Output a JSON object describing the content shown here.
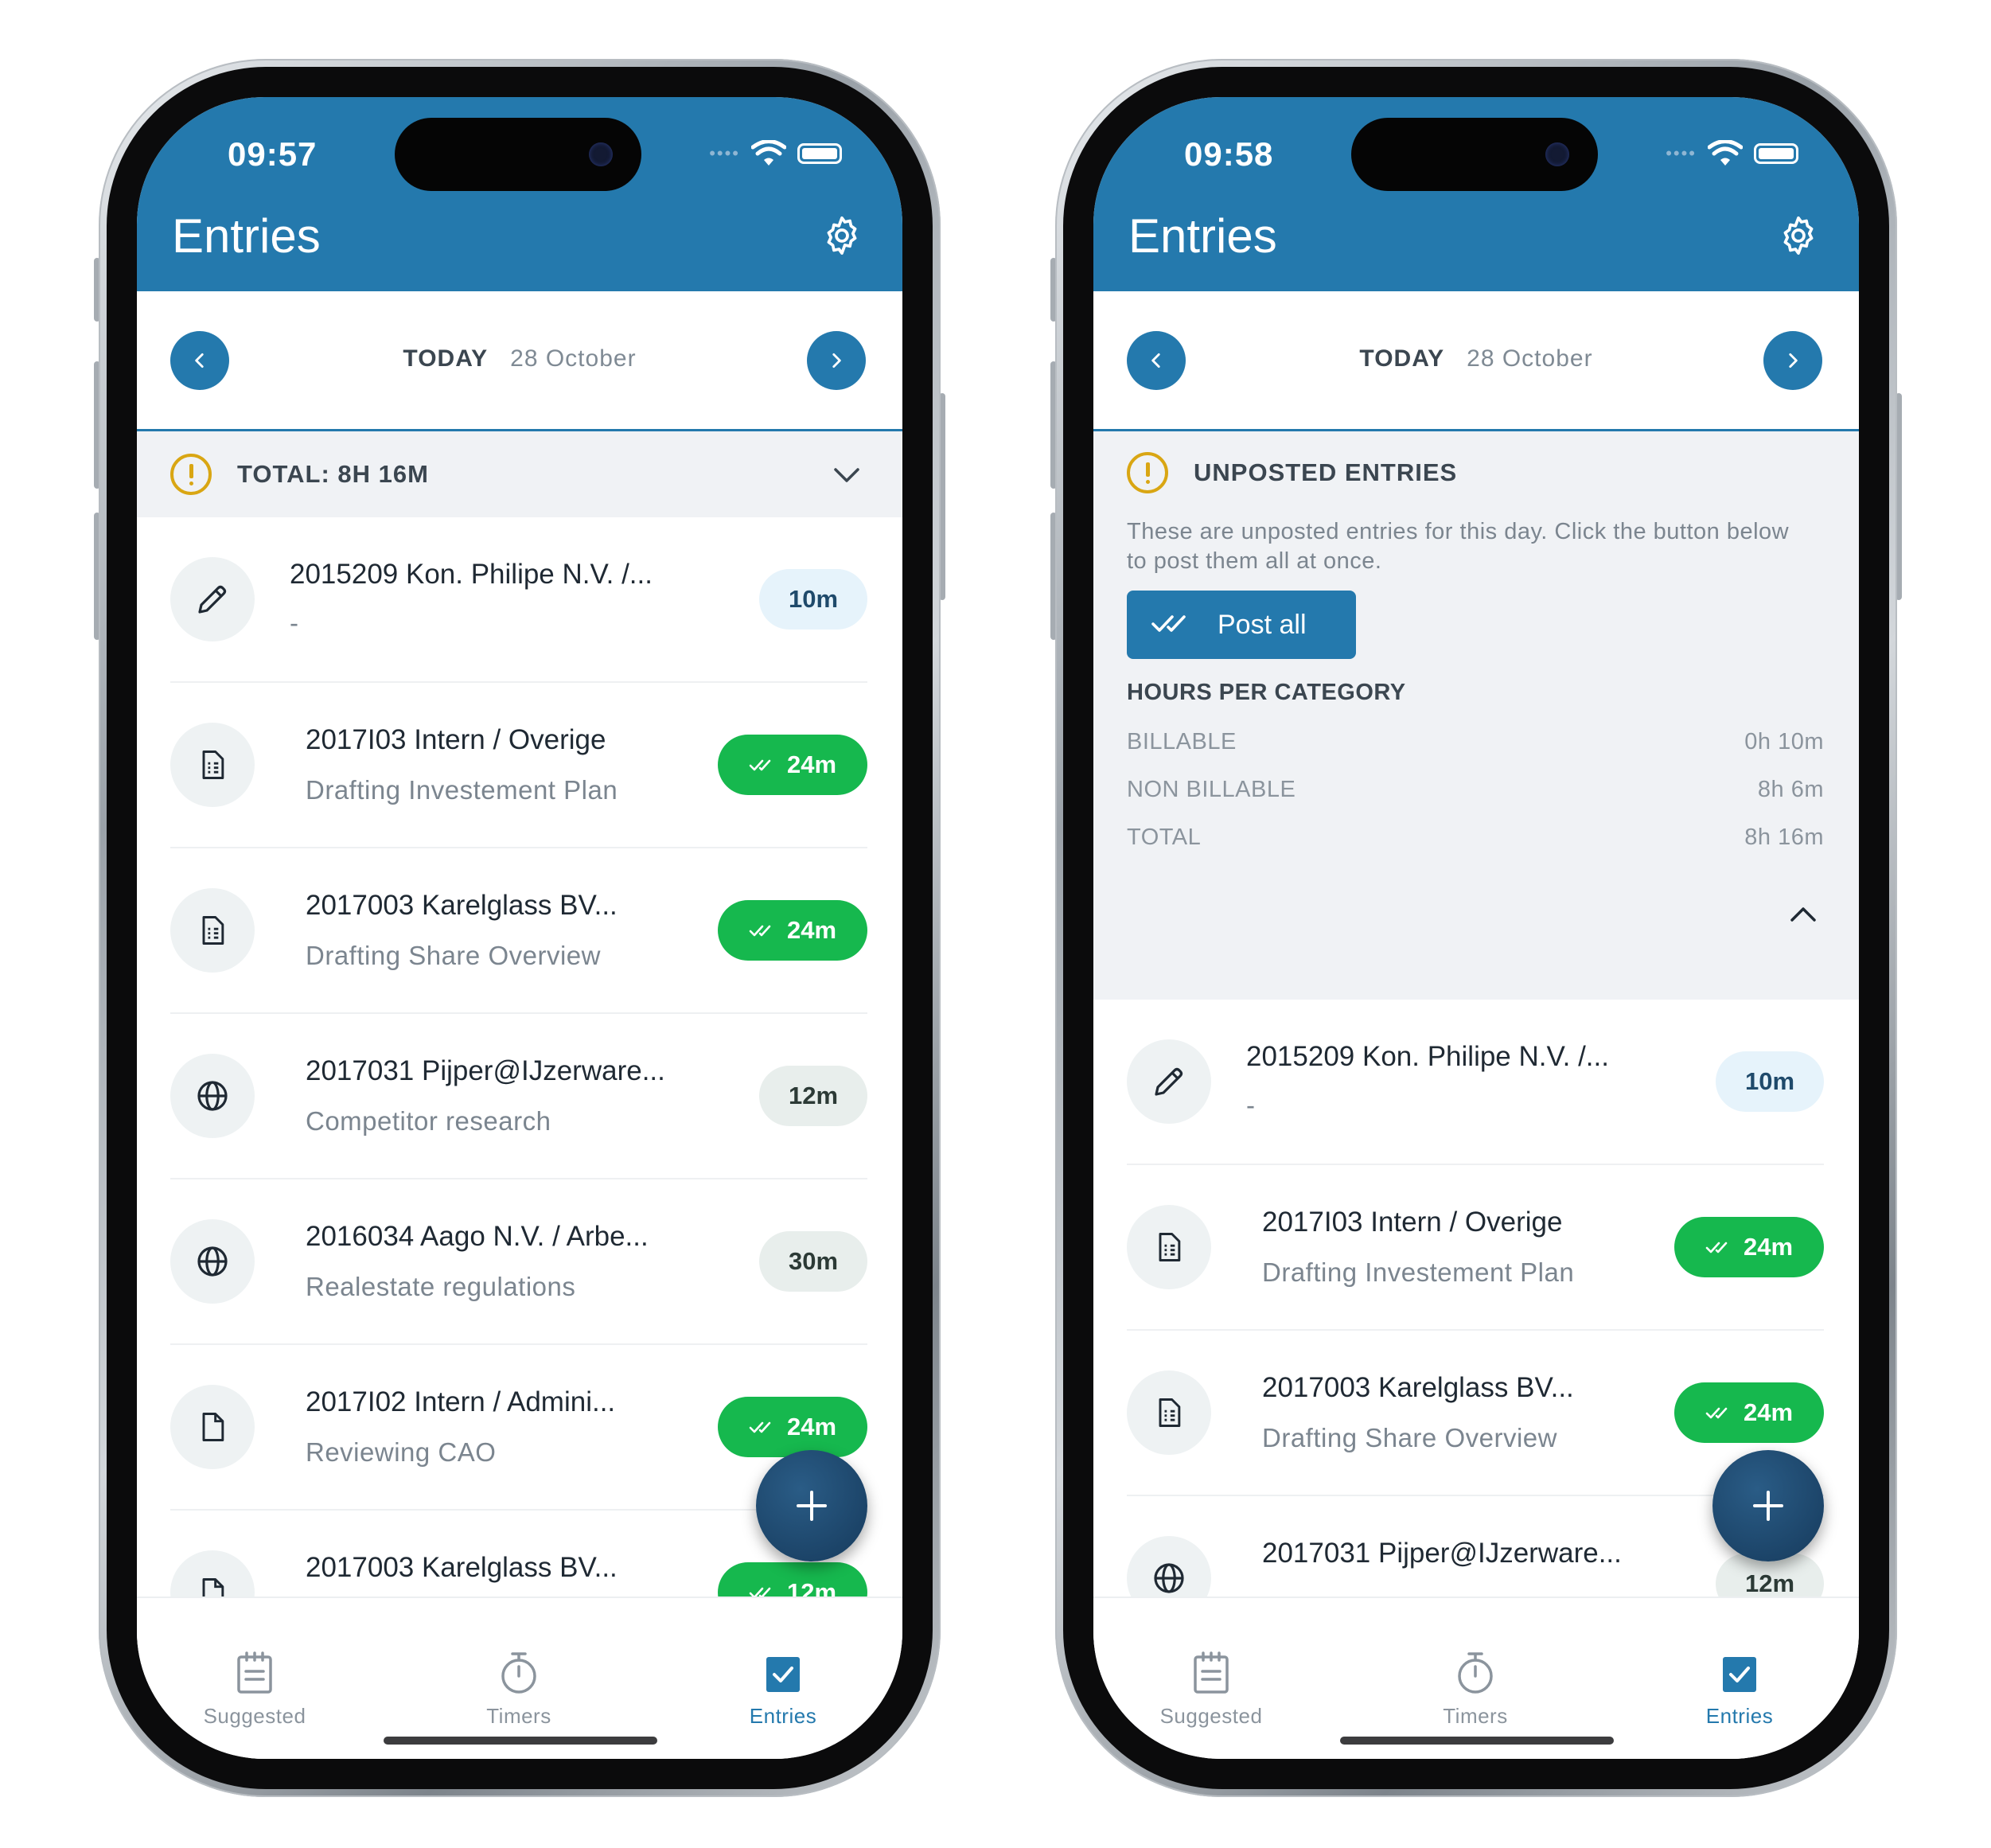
{
  "phones": [
    {
      "status": {
        "time": "09:57",
        "dots": "••••"
      },
      "header": {
        "title": "Entries",
        "settings_icon": "gear-icon"
      },
      "datebar": {
        "today_label": "TODAY",
        "date": "28 October"
      },
      "summary": {
        "title": "TOTAL: 8H 16M"
      },
      "entries": [
        {
          "code": "2015209 Kon. Philipe N.V. /...",
          "desc": "-",
          "duration": "10m",
          "icon": "pencil-icon",
          "style": "light"
        },
        {
          "code": "2017I03 Intern / Overige",
          "desc": "Drafting Investement Plan",
          "duration": "24m",
          "icon": "document-icon",
          "style": "green"
        },
        {
          "code": "2017003 Karelglass BV...",
          "desc": "Drafting Share Overview",
          "duration": "24m",
          "icon": "document-icon",
          "style": "green"
        },
        {
          "code": "2017031 Pijper@IJzerware...",
          "desc": "Competitor research",
          "duration": "12m",
          "icon": "globe-icon",
          "style": "grey"
        },
        {
          "code": "2016034 Aago N.V. / Arbe...",
          "desc": "Realestate regulations",
          "duration": "30m",
          "icon": "globe-icon",
          "style": "grey"
        },
        {
          "code": "2017I02 Intern / Admini...",
          "desc": "Reviewing CAO",
          "duration": "24m",
          "icon": "file-icon",
          "style": "green"
        },
        {
          "code": "2017003 Karelglass BV...",
          "desc": "",
          "duration": "12m",
          "icon": "file-icon",
          "style": "green"
        }
      ],
      "tabs": [
        {
          "label": "Suggested"
        },
        {
          "label": "Timers"
        },
        {
          "label": "Entries"
        }
      ]
    },
    {
      "status": {
        "time": "09:58",
        "dots": "••••"
      },
      "header": {
        "title": "Entries",
        "settings_icon": "gear-icon"
      },
      "datebar": {
        "today_label": "TODAY",
        "date": "28 October"
      },
      "summary": {
        "title": "UNPOSTED ENTRIES",
        "description": "These are unposted entries for this day. Click the button below to post them all at once.",
        "post_all_label": "Post all",
        "hours_title": "HOURS PER CATEGORY",
        "categories": [
          {
            "name": "BILLABLE",
            "value": "0h 10m"
          },
          {
            "name": "NON BILLABLE",
            "value": "8h 6m"
          },
          {
            "name": "TOTAL",
            "value": "8h 16m"
          }
        ]
      },
      "entries": [
        {
          "code": "2015209 Kon. Philipe N.V. /...",
          "desc": "-",
          "duration": "10m",
          "icon": "pencil-icon",
          "style": "light"
        },
        {
          "code": "2017I03 Intern / Overige",
          "desc": "Drafting Investement Plan",
          "duration": "24m",
          "icon": "document-icon",
          "style": "green"
        },
        {
          "code": "2017003 Karelglass BV...",
          "desc": "Drafting Share Overview",
          "duration": "24m",
          "icon": "document-icon",
          "style": "green"
        },
        {
          "code": "2017031 Pijper@IJzerware...",
          "desc": "",
          "duration": "12m",
          "icon": "globe-icon",
          "style": "grey"
        }
      ],
      "tabs": [
        {
          "label": "Suggested"
        },
        {
          "label": "Timers"
        },
        {
          "label": "Entries"
        }
      ]
    }
  ],
  "colors": {
    "brand": "#2479ad",
    "posted_green": "#16b84e",
    "warning": "#d9a613",
    "fab": "#163a5c"
  }
}
